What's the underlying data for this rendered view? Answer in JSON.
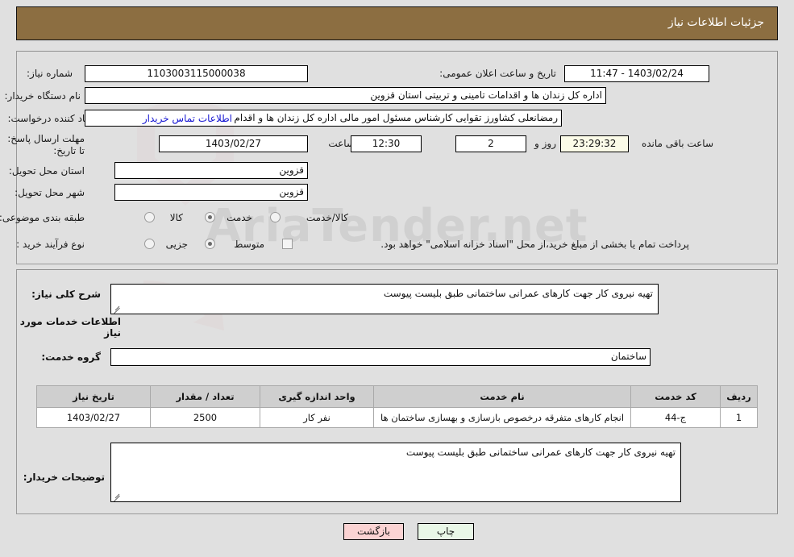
{
  "header": {
    "title": "جزئیات اطلاعات نیاز",
    "bar_color": "#8c6e41"
  },
  "watermark": {
    "text": "AriaTender.net"
  },
  "top_form": {
    "need_number": {
      "label": "شماره نیاز:",
      "value": "1103003115000038"
    },
    "public_announce": {
      "label": "تاریخ و ساعت اعلان عمومی:",
      "value": "1403/02/24 - 11:47"
    },
    "buyer_org": {
      "label": "نام دستگاه خریدار:",
      "value": "اداره کل زندان ها و اقدامات تامینی و تربیتی استان قزوین"
    },
    "creator": {
      "label": "ایجاد کننده درخواست:",
      "value": "رمضانعلی کشاورز تقوایی کارشناس مسئول امور مالی  اداره کل زندان ها و اقدام",
      "link": "اطلاعات تماس خریدار"
    },
    "deadline": {
      "label": "مهلت ارسال پاسخ: تا تاریخ:",
      "date": "1403/02/27",
      "time_label": "ساعت",
      "time": "12:30",
      "days": "2",
      "days_label": "روز و",
      "countdown": "23:29:32",
      "remaining_label": "ساعت باقی مانده"
    },
    "province": {
      "label": "استان محل تحویل:",
      "value": "قزوین"
    },
    "city": {
      "label": "شهر محل تحویل:",
      "value": "قزوین"
    },
    "category": {
      "label": "طبقه بندی موضوعی:",
      "options": [
        {
          "label": "کالا",
          "selected": false
        },
        {
          "label": "خدمت",
          "selected": true
        },
        {
          "label": "کالا/خدمت",
          "selected": false
        }
      ]
    },
    "purchase_type": {
      "label": "نوع فرآیند خرید :",
      "options": [
        {
          "label": "جزیی",
          "selected": false
        },
        {
          "label": "متوسط",
          "selected": true
        }
      ],
      "note": "پرداخت تمام یا بخشی از مبلغ خرید،از محل \"اسناد خزانه اسلامی\" خواهد بود.",
      "note_checked": false
    }
  },
  "bottom": {
    "need_desc": {
      "label": "شرح کلی نیاز:",
      "value": "تهیه نیروی کار جهت کارهای عمرانی ساختمانی طبق بلیست پیوست"
    },
    "services_heading": "اطلاعات خدمات مورد نیاز",
    "service_group": {
      "label": "گروه خدمت:",
      "value": "ساختمان"
    },
    "table": {
      "columns": [
        "ردیف",
        "کد خدمت",
        "نام خدمت",
        "واحد اندازه گیری",
        "تعداد / مقدار",
        "تاریخ نیاز"
      ],
      "rows": [
        {
          "row": "1",
          "code": "ج-44",
          "name": "انجام کارهای متفرقه درخصوص بازسازی و بهسازی ساختمان ها",
          "unit": "نفر کار",
          "qty": "2500",
          "date": "1403/02/27"
        }
      ]
    },
    "buyer_notes": {
      "label": "توضیحات خریدار:",
      "value": "تهیه نیروی کار جهت کارهای عمرانی ساختمانی طبق بلیست پیوست"
    }
  },
  "buttons": {
    "print": "چاپ",
    "back": "بازگشت"
  }
}
